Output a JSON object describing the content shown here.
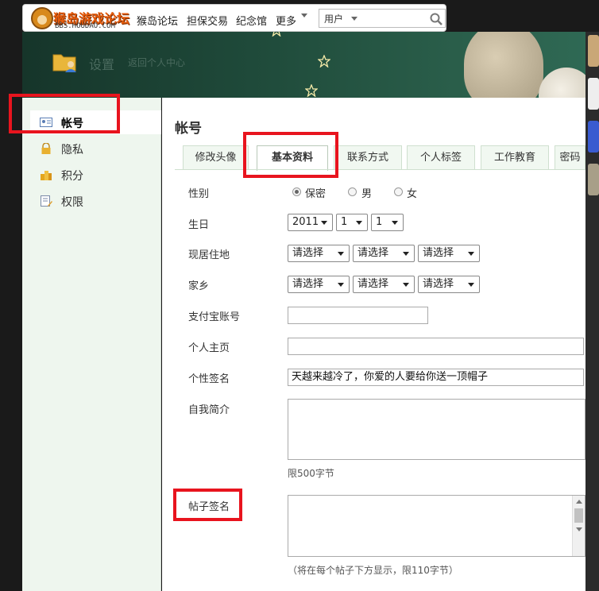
{
  "topnav": {
    "logo_name": "猴岛游戏论坛",
    "logo_url": "BBS.HOUDAO.COM",
    "links": [
      "猴岛论坛",
      "担保交易",
      "纪念馆",
      "更多"
    ],
    "search_select": "用户"
  },
  "banner": {
    "title": "设置",
    "back_link": "返回个人中心"
  },
  "sidebar": {
    "items": [
      {
        "label": "帐号",
        "icon": "id-card-icon",
        "active": true
      },
      {
        "label": "隐私",
        "icon": "lock-icon",
        "active": false
      },
      {
        "label": "积分",
        "icon": "coins-icon",
        "active": false
      },
      {
        "label": "权限",
        "icon": "document-edit-icon",
        "active": false
      }
    ]
  },
  "main": {
    "title": "帐号",
    "tabs": [
      "修改头像",
      "基本资料",
      "联系方式",
      "个人标签",
      "工作教育",
      "密码"
    ],
    "active_tab": "基本资料"
  },
  "form": {
    "gender": {
      "label": "性别",
      "options": [
        "保密",
        "男",
        "女"
      ],
      "selected": "保密"
    },
    "birthday": {
      "label": "生日",
      "year": "2011",
      "month": "1",
      "day": "1"
    },
    "residence": {
      "label": "现居住地",
      "selects": [
        "请选择",
        "请选择",
        "请选择"
      ]
    },
    "hometown": {
      "label": "家乡",
      "selects": [
        "请选择",
        "请选择",
        "请选择"
      ]
    },
    "alipay": {
      "label": "支付宝账号",
      "value": ""
    },
    "homepage": {
      "label": "个人主页",
      "value": ""
    },
    "signature": {
      "label": "个性签名",
      "value": "天越来越冷了，你爱的人要给你送一顶帽子"
    },
    "bio": {
      "label": "自我简介",
      "value": "",
      "hint": "限500字节"
    },
    "post_signature": {
      "label": "帖子签名",
      "value": "",
      "hint": "（将在每个帖子下方显示，限110字节）"
    }
  },
  "colors": {
    "highlight": "#e8141e",
    "sidebar_bg": "#eef6ee",
    "tab_bg": "#f1f8f1",
    "banner_bg": "#1f4a3a"
  }
}
